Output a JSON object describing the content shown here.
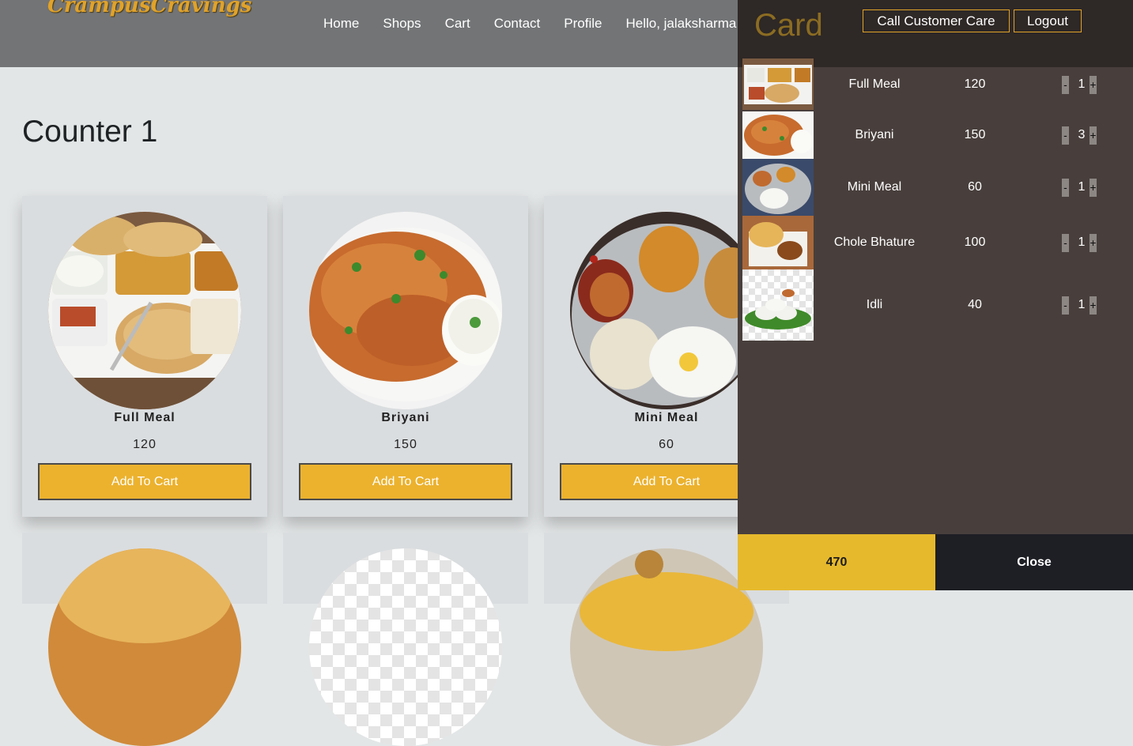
{
  "brand": "CrampusCravings",
  "nav": {
    "items": [
      "Home",
      "Shops",
      "Cart",
      "Contact",
      "Profile",
      "Hello, jalaksharma"
    ]
  },
  "main": {
    "title": "Counter 1",
    "items": [
      {
        "name": "Full Meal",
        "price": "120",
        "button": "Add To Cart"
      },
      {
        "name": "Briyani",
        "price": "150",
        "button": "Add To Cart"
      },
      {
        "name": "Mini Meal",
        "price": "60",
        "button": "Add To Cart"
      }
    ]
  },
  "cart": {
    "title": "Card",
    "call_label": "Call Customer Care",
    "logout_label": "Logout",
    "items": [
      {
        "name": "Full Meal",
        "price": "120",
        "qty": "1"
      },
      {
        "name": "Briyani",
        "price": "150",
        "qty": "3"
      },
      {
        "name": "Mini Meal",
        "price": "60",
        "qty": "1"
      },
      {
        "name": "Chole Bhature",
        "price": "100",
        "qty": "1"
      },
      {
        "name": "Idli",
        "price": "40",
        "qty": "1"
      }
    ],
    "minus": "-",
    "plus": "+",
    "total": "470",
    "close_label": "Close"
  },
  "colors": {
    "accent": "#ecb22e",
    "header": "#727476",
    "panel": "#483f3c",
    "close_bg": "#1e1f25"
  }
}
